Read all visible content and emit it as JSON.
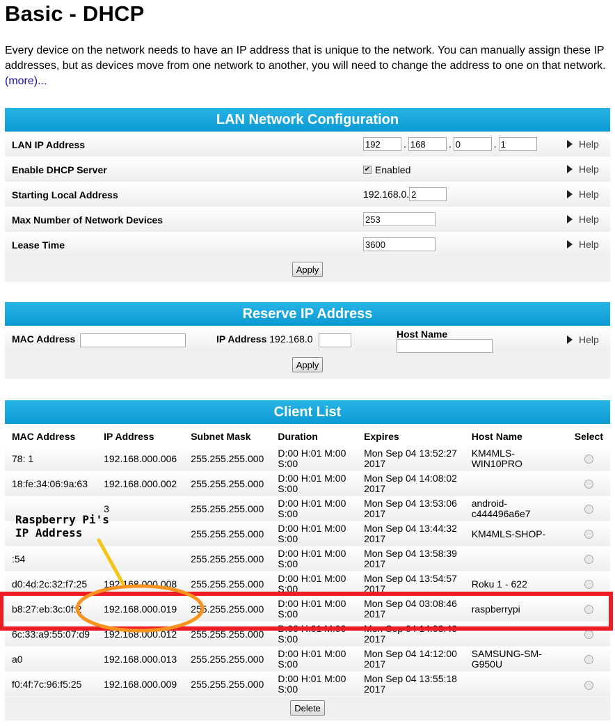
{
  "page": {
    "title": "Basic - DHCP",
    "intro": "Every device on the network needs to have an IP address that is unique to the network. You can manually assign these IP addresses, but as devices move from one network to another, you will need to change the address to one on that network.",
    "more_link": "(more)..."
  },
  "lan": {
    "header": "LAN Network Configuration",
    "rows": {
      "lan_ip_label": "LAN IP Address",
      "ip_octets": [
        "192",
        "168",
        "0",
        "1"
      ],
      "dhcp_label": "Enable DHCP Server",
      "dhcp_value": "Enabled",
      "start_label": "Starting Local Address",
      "start_prefix": "192.168.0.",
      "start_value": "2",
      "max_label": "Max Number of Network Devices",
      "max_value": "253",
      "lease_label": "Lease Time",
      "lease_value": "3600"
    },
    "help": "Help",
    "apply": "Apply"
  },
  "reserve": {
    "header": "Reserve IP Address",
    "mac_label": "MAC Address",
    "ip_label": "IP Address",
    "ip_prefix": "192.168.0",
    "host_label": "Host Name",
    "help": "Help",
    "apply": "Apply"
  },
  "clients": {
    "header": "Client List",
    "columns": [
      "MAC Address",
      "IP Address",
      "Subnet Mask",
      "Duration",
      "Expires",
      "Host Name",
      "Select"
    ],
    "rows": [
      {
        "mac": "78:                  1",
        "ip": "192.168.000.006",
        "mask": "255.255.255.000",
        "dur1": "D:00 H:01 M:00",
        "dur2": "S:00",
        "exp1": "Mon Sep 04 13:52:27",
        "exp2": "2017",
        "host": "KM4MLS-WIN10PRO"
      },
      {
        "mac": "18:fe:34:06:9a:63",
        "ip": "192.168.000.002",
        "mask": "255.255.255.000",
        "dur1": "D:00 H:01 M:00",
        "dur2": "S:00",
        "exp1": "Mon Sep 04 14:08:02",
        "exp2": "2017",
        "host": ""
      },
      {
        "mac": "",
        "ip": "                    3",
        "mask": "255.255.255.000",
        "dur1": "D:00 H:01 M:00",
        "dur2": "S:00",
        "exp1": "Mon Sep 04 13:53:06",
        "exp2": "2017",
        "host": "android-c444496a6e7"
      },
      {
        "mac": "",
        "ip": "",
        "mask": "255.255.255.000",
        "dur1": "D:00 H:01 M:00",
        "dur2": "S:00",
        "exp1": "Mon Sep 04 13:44:32",
        "exp2": "2017",
        "host": "KM4MLS-SHOP-"
      },
      {
        "mac": "               :54",
        "ip": "",
        "mask": "255.255.255.000",
        "dur1": "D:00 H:01 M:00",
        "dur2": "S:00",
        "exp1": "Mon Sep 04 13:58:39",
        "exp2": "2017",
        "host": ""
      },
      {
        "mac": "d0:4d:2c:32:f7:25",
        "ip": "192.168.000.008",
        "mask": "255.255.255.000",
        "dur1": "D:00 H:01 M:00",
        "dur2": "S:00",
        "exp1": "Mon Sep 04 13:54:57",
        "exp2": "2017",
        "host": "Roku 1 - 622"
      },
      {
        "mac": "b8:27:eb:3c:0f:2",
        "ip": "192.168.000.019",
        "mask": "255.255.255.000",
        "dur1": "D:00 H:01 M:00",
        "dur2": "S:00",
        "exp1": "Mon Sep 04 03:08:46",
        "exp2": "2017",
        "host": "raspberrypi"
      },
      {
        "mac": "6c:33:a9:55:07:d9",
        "ip": "192.168.000.012",
        "mask": "255.255.255.000",
        "dur1": "D:00 H:01 M:00",
        "dur2": "S:00",
        "exp1": "Mon Sep 04 14:03:46",
        "exp2": "2017",
        "host": ""
      },
      {
        "mac": "a0                   ",
        "ip": "192.168.000.013",
        "mask": "255.255.255.000",
        "dur1": "D:00 H:01 M:00",
        "dur2": "S:00",
        "exp1": "Mon Sep 04 14:12:00",
        "exp2": "2017",
        "host": "SAMSUNG-SM-G950U"
      },
      {
        "mac": "f0:4f:7c:96:f5:25",
        "ip": "192.168.000.009",
        "mask": "255.255.255.000",
        "dur1": "D:00 H:01 M:00",
        "dur2": "S:00",
        "exp1": "Mon Sep 04 13:55:18",
        "exp2": "2017",
        "host": ""
      }
    ],
    "delete": "Delete"
  },
  "annotation": {
    "line1": "Raspberry Pi's",
    "line2": "IP Address",
    "highlight_color": "#ee1c24",
    "circle_color": "#f7931e",
    "arrow_color": "#f5c518"
  }
}
